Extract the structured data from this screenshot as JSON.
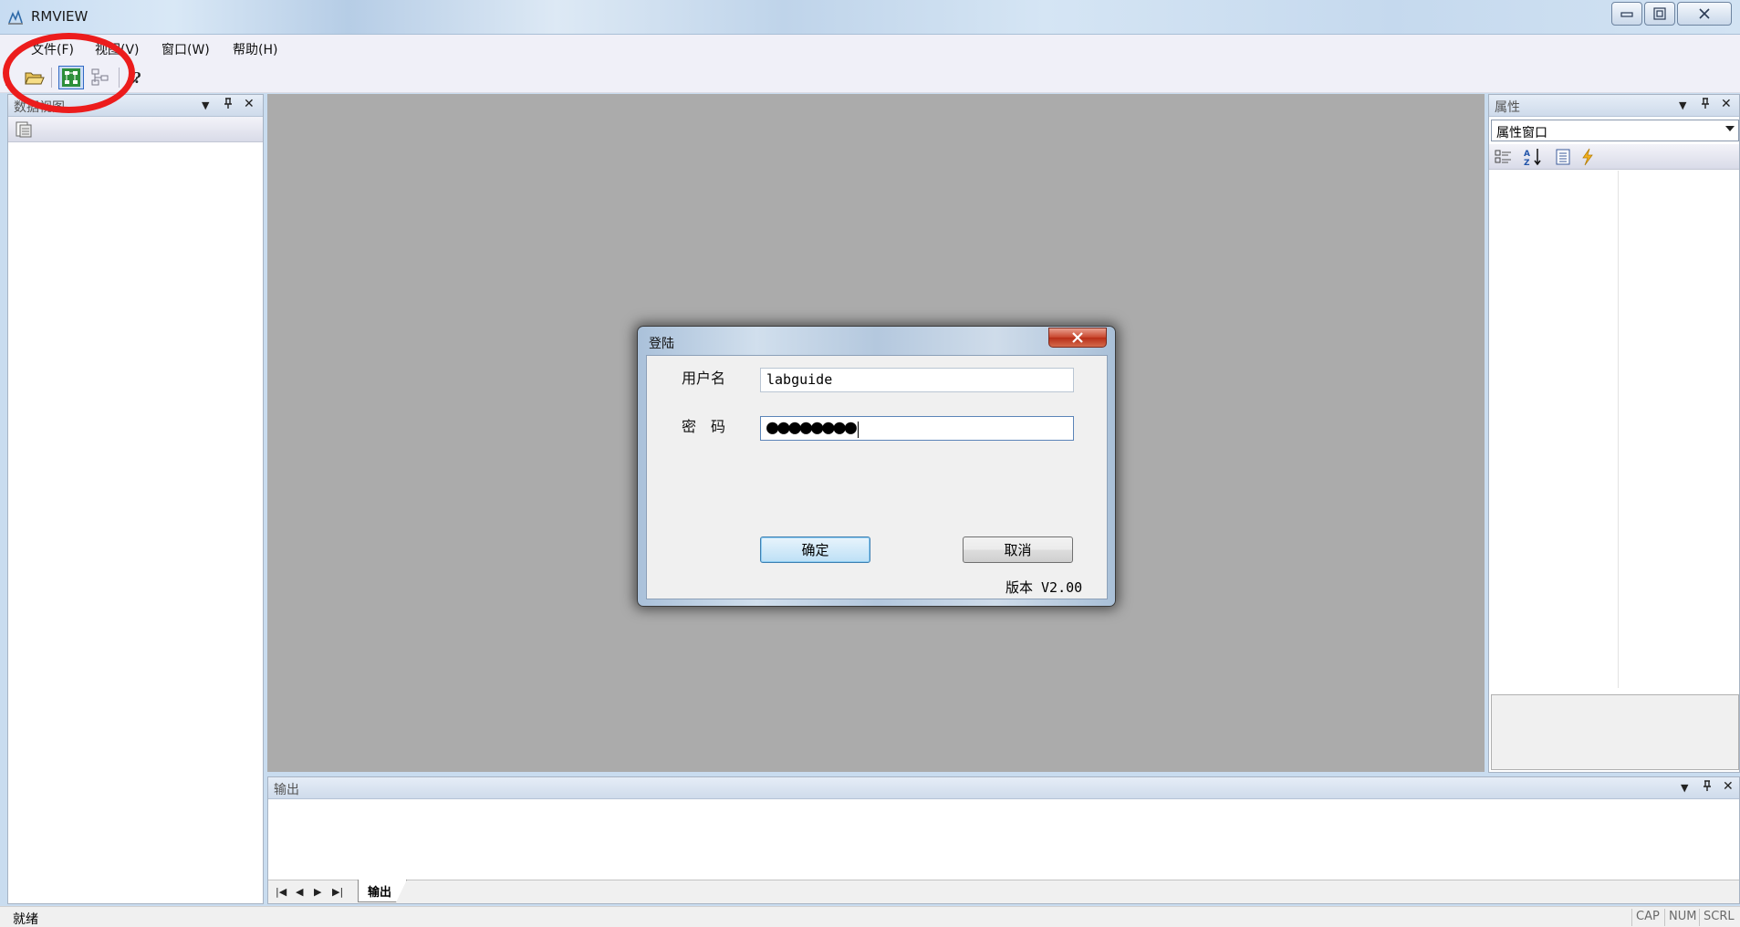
{
  "window": {
    "title": "RMVIEW",
    "controls": {
      "minimize": "minimize",
      "maximize": "maximize",
      "close": "close"
    }
  },
  "menu": {
    "items": [
      {
        "label": "文件(F)"
      },
      {
        "label": "视图(V)"
      },
      {
        "label": "窗口(W)"
      },
      {
        "label": "帮助(H)"
      }
    ]
  },
  "toolbar": {
    "buttons": [
      {
        "icon": "open-folder-icon",
        "active": false
      },
      {
        "icon": "tree-view-icon",
        "active": true
      },
      {
        "icon": "tree-layout-icon",
        "active": false
      },
      {
        "icon": "help-icon",
        "active": false
      }
    ]
  },
  "left_panel": {
    "title": "数据视图",
    "controls": {
      "dropdown": "▼",
      "pin": "ㅁ",
      "close": "✕"
    }
  },
  "right_panel": {
    "title": "属性",
    "combo_value": "属性窗口",
    "controls": {
      "dropdown": "▼",
      "pin": "ㅁ",
      "close": "✕"
    }
  },
  "output_panel": {
    "title": "输出",
    "tab_label": "输出",
    "nav": {
      "first": "|◀",
      "prev": "◀",
      "next": "▶",
      "last": "▶|"
    }
  },
  "dialog": {
    "title": "登陆",
    "username_label": "用户名",
    "username_value": "labguide",
    "password_label": "密　码",
    "password_mask": "●●●●●●●●",
    "ok_label": "确定",
    "cancel_label": "取消",
    "version": "版本 V2.00"
  },
  "status": {
    "text": "就绪",
    "indicators": [
      "CAP",
      "NUM",
      "SCRL"
    ]
  },
  "colors": {
    "annotation": "#ec1c1c",
    "mdi_background": "#ababab",
    "dialog_close": "#c7442b"
  }
}
